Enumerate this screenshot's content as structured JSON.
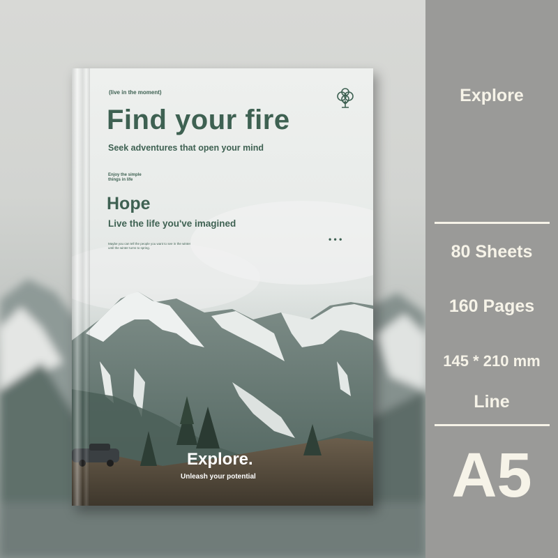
{
  "cover": {
    "tagline": "(live in the moment)",
    "headline": "Find your fire",
    "subheadline": "Seek adventures that open your mind",
    "small_note_1": "Enjoy the simple",
    "small_note_2": "things in life",
    "section_title": "Hope",
    "section_subtitle": "Live the life you've imagined",
    "fine_print_1": "Maybe you can tell the people you want to see in the winter",
    "fine_print_2": "until the winter turns to spring.",
    "dots": "• • •",
    "bottom_title": "Explore.",
    "bottom_subtitle": "Unleash your potential",
    "logo_icon": "tree-icon",
    "accent_color": "#3e6152"
  },
  "panel": {
    "title": "Explore",
    "sheets": "80 Sheets",
    "pages": "160 Pages",
    "size": "145 * 210 mm",
    "ruling": "Line",
    "format": "A5",
    "background_color": "#9a9a98",
    "text_color": "#f6f3e8"
  }
}
